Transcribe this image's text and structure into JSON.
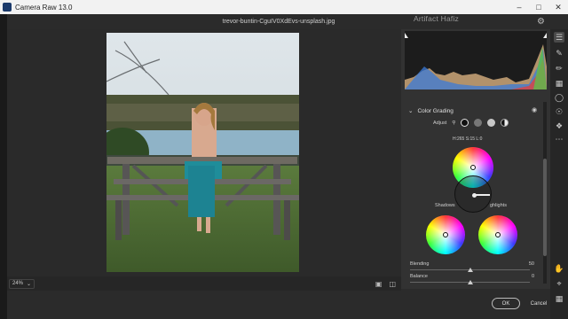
{
  "app": {
    "title": "Camera Raw 13.0"
  },
  "header": {
    "filename": "trevor-buntin-CguIV0XdEvs-unsplash.jpg"
  },
  "watermark": "Artifact Hafiz",
  "canvas": {
    "zoom": "24%"
  },
  "panel": {
    "section_title": "Color Grading",
    "adjust_label": "Adjust",
    "hsl": {
      "h_label": "H:",
      "h": "265",
      "s_label": "S:",
      "s": "15",
      "l_label": "L:",
      "l": "0"
    },
    "shadows_label": "Shadows",
    "highlights_label": "ghlights",
    "blending": {
      "label": "Blending",
      "value": "50"
    },
    "balance": {
      "label": "Balance",
      "value": "0"
    }
  },
  "footer": {
    "ok_label": "OK",
    "cancel_label": "Cancel"
  },
  "colors": {
    "accent": "#2f6fb0",
    "panel_bg": "#323232",
    "canvas_bg": "#2a2a2a"
  }
}
